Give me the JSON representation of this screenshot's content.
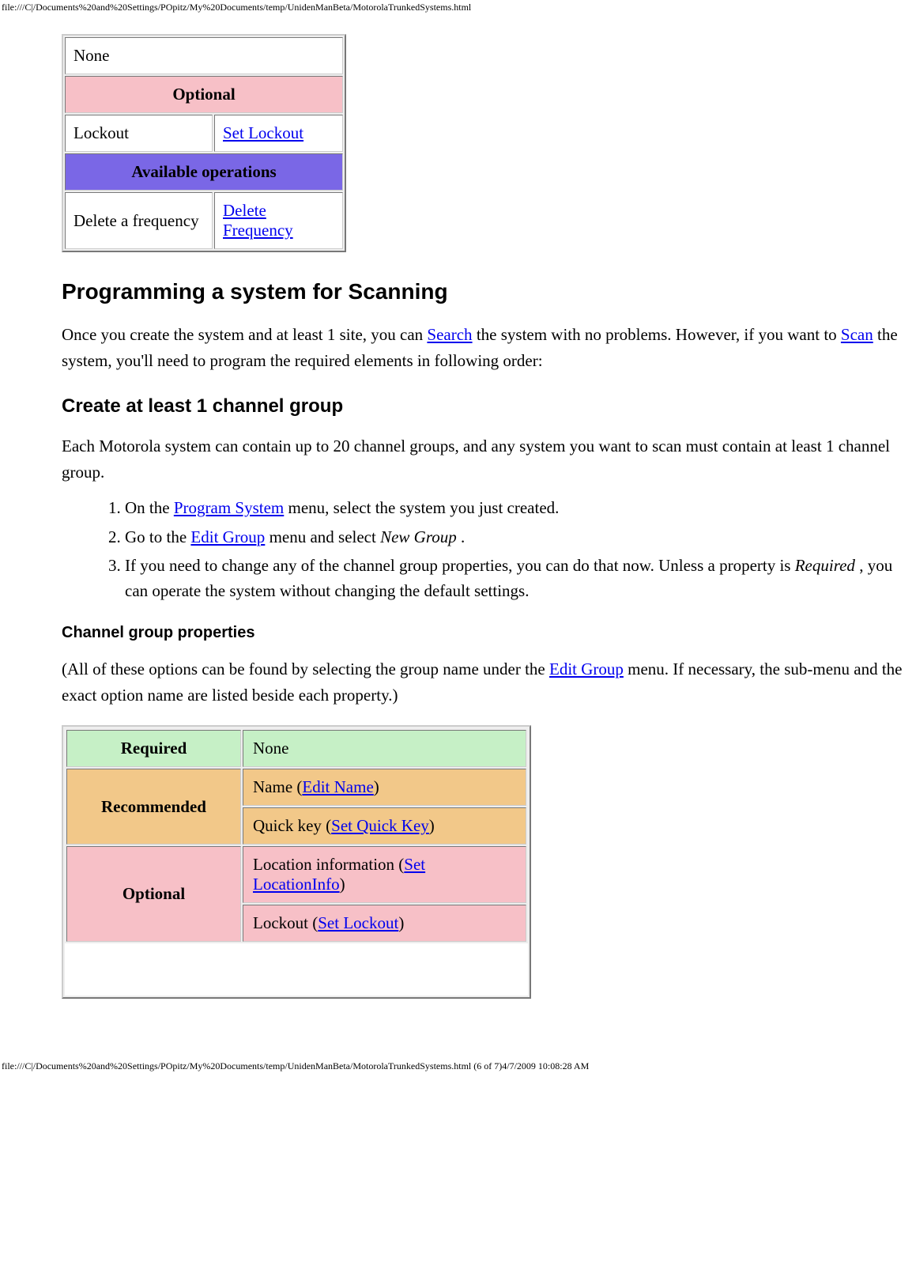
{
  "header": {
    "path": "file:///C|/Documents%20and%20Settings/POpitz/My%20Documents/temp/UnidenManBeta/MotorolaTrunkedSystems.html"
  },
  "footer": {
    "path": "file:///C|/Documents%20and%20Settings/POpitz/My%20Documents/temp/UnidenManBeta/MotorolaTrunkedSystems.html (6 of 7)4/7/2009 10:08:28 AM"
  },
  "table1": {
    "none": "None",
    "optional_header": "Optional",
    "lockout_label": "Lockout",
    "lockout_link": "Set Lockout",
    "ops_header": "Available operations",
    "delete_label": "Delete a frequency",
    "delete_link": "Delete Frequency"
  },
  "sec1": {
    "title": "Programming a system for Scanning",
    "p1a": "Once you create the system and at least 1 site, you can ",
    "link_search": "Search",
    "p1b": " the system with no problems. However, if you want to ",
    "link_scan": "Scan",
    "p1c": " the system, you'll need to program the required elements in following order:"
  },
  "sec2": {
    "title": "Create at least 1 channel group",
    "p1": "Each Motorola system can contain up to 20 channel groups, and any system you want to scan must contain at least 1 channel group.",
    "li1a": "On the ",
    "li1_link": "Program System",
    "li1b": " menu, select the system you just created.",
    "li2a": "Go to the ",
    "li2_link": "Edit Group",
    "li2b": " menu and select ",
    "li2_em": "New Group",
    "li2c": " .",
    "li3a": "If you need to change any of the channel group properties, you can do that now. Unless a property is ",
    "li3_em": "Required",
    "li3b": " , you can operate the system without changing the default settings."
  },
  "sec3": {
    "title": "Channel group properties",
    "p1a": "(All of these options can be found by selecting the group name under the ",
    "link_eg": "Edit Group",
    "p1b": " menu. If necessary, the sub-menu and the exact option name are listed beside each property.)"
  },
  "table2": {
    "required": "Required",
    "required_val": "None",
    "recommended": "Recommended",
    "rec1a": "Name (",
    "rec1_link": "Edit Name",
    "rec1b": ")",
    "rec2a": "Quick key (",
    "rec2_link": "Set Quick Key",
    "rec2b": ")",
    "optional": "Optional",
    "opt1a": "Location information (",
    "opt1_link": "Set LocationInfo",
    "opt1b": ")",
    "opt2a": "Lockout (",
    "opt2_link": "Set Lockout",
    "opt2b": ")"
  }
}
